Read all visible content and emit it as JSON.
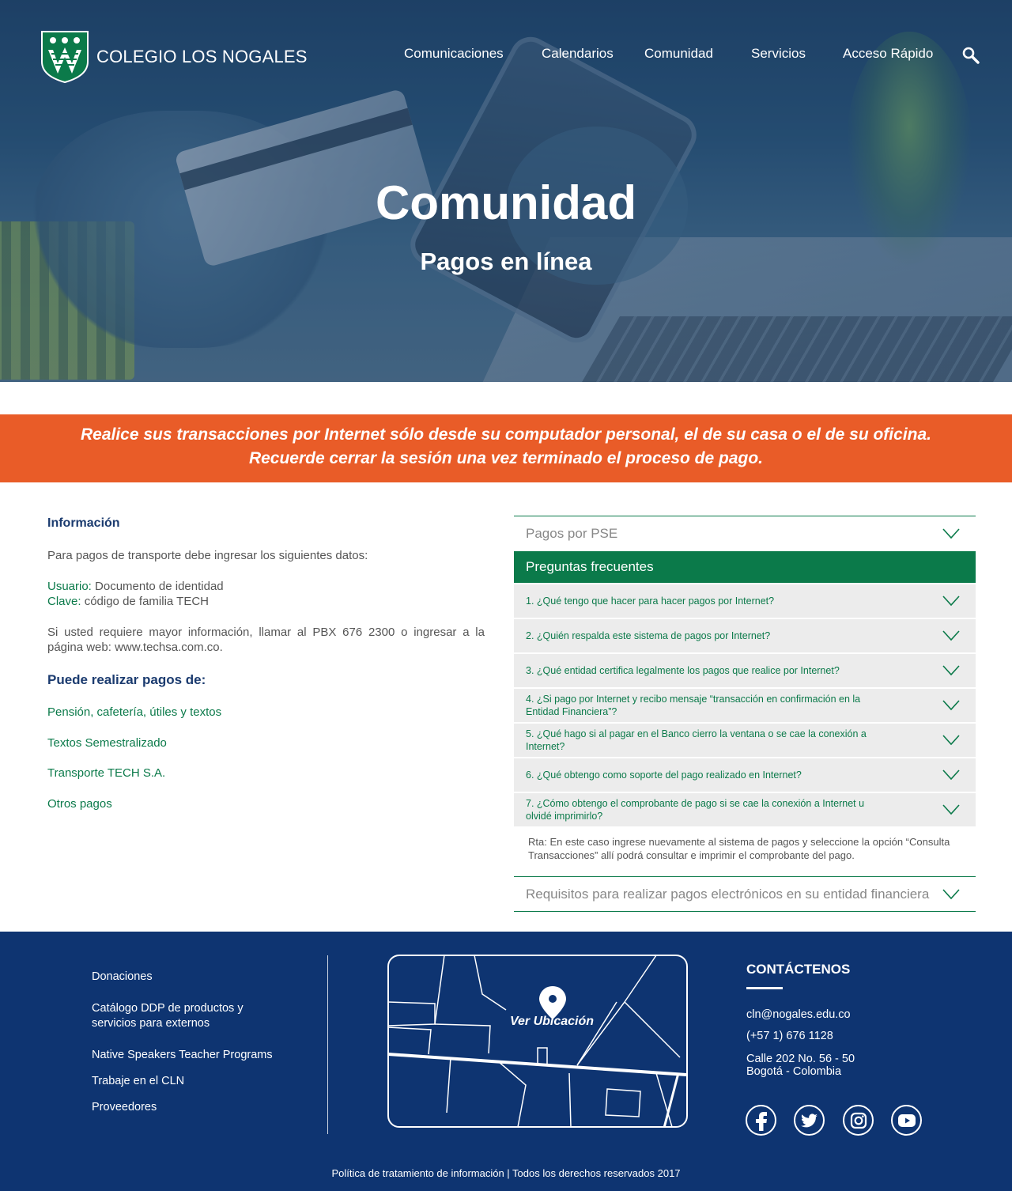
{
  "brand": {
    "name": "COLEGIO LOS NOGALES"
  },
  "nav": {
    "items": [
      "Comunicaciones",
      "Calendarios",
      "Comunidad",
      "Servicios",
      "Acceso Rápido"
    ],
    "search_icon": "search-icon"
  },
  "hero": {
    "title": "Comunidad",
    "subtitle": "Pagos en línea"
  },
  "notice": {
    "line1": "Realice sus transacciones por Internet sólo desde su computador personal, el de su casa o el de su oficina.",
    "line2": "Recuerde cerrar la sesión una vez terminado el proceso de pago."
  },
  "info": {
    "heading": "Información",
    "intro": "Para pagos de transporte debe ingresar los siguientes datos:",
    "user_label": "Usuario:",
    "user_value": " Documento de identidad",
    "key_label": "Clave:",
    "key_value": " código de familia TECH",
    "more": "Si usted requiere mayor información, llamar al PBX 676 2300 o ingresar a la página web: www.techsa.com.co.",
    "payments_heading": "Puede realizar pagos de:",
    "payments": [
      "Pensión, cafetería, útiles y textos",
      "Textos Semestralizado",
      "Transporte TECH S.A.",
      "Otros pagos"
    ]
  },
  "accordion": {
    "pse": "Pagos por PSE",
    "faq_title": "Preguntas frecuentes",
    "faqs": [
      "1. ¿Qué tengo que hacer para hacer pagos por Internet?",
      "2. ¿Quién respalda este sistema de pagos por Internet?",
      "3. ¿Qué entidad certifica legalmente los pagos que realice por Internet?",
      "4. ¿Si pago por Internet y recibo mensaje “transacción en confirmación en la Entidad Financiera”?",
      "5. ¿Qué hago si al pagar en el Banco cierro la ventana o se cae la conexión a Internet?",
      "6. ¿Qué obtengo como soporte del pago realizado en Internet?",
      "7. ¿Cómo obtengo el comprobante de pago si se cae la conexión a Internet u olvidé imprimirlo?"
    ],
    "answer": "Rta: En este caso ingrese nuevamente al sistema de pagos y seleccione la opción “Consulta Transacciones” allí podrá consultar e imprimir el comprobante del pago.",
    "requirements": "Requisitos para realizar pagos electrónicos en su entidad financiera"
  },
  "footer": {
    "links": [
      "Donaciones",
      "Catálogo DDP de productos y servicios para externos",
      "Native Speakers Teacher Programs",
      "Trabaje en el CLN",
      "Proveedores"
    ],
    "map_label": "Ver Ubicación",
    "contact_heading": "CONTÁCTENOS",
    "email": "cln@nogales.edu.co",
    "phone": "(+57 1) 676 1128",
    "address1": "Calle 202 No. 56 - 50",
    "address2": "Bogotá - Colombia",
    "social": [
      "facebook-icon",
      "twitter-icon",
      "instagram-icon",
      "youtube-icon"
    ],
    "copyright": "Política de tratamiento de información | Todos los derechos reservados 2017"
  },
  "colors": {
    "navy": "#0e3471",
    "green": "#0b7a4a",
    "orange": "#e95c28",
    "gray_row": "#ececec"
  }
}
